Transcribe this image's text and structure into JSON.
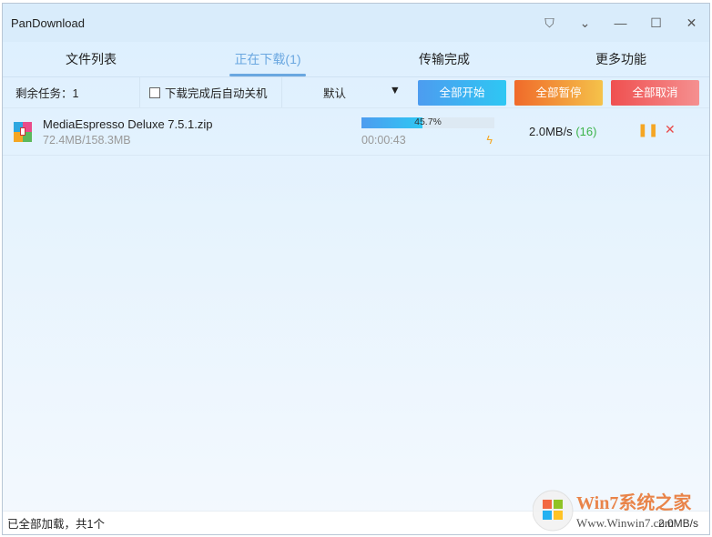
{
  "app": {
    "title": "PanDownload"
  },
  "tabs": [
    {
      "label": "文件列表"
    },
    {
      "label": "正在下载(1)"
    },
    {
      "label": "传输完成"
    },
    {
      "label": "更多功能"
    }
  ],
  "toolbar": {
    "remaining": "剩余任务：1",
    "shutdown_label": "下载完成后自动关机",
    "sort_value": "默认",
    "start_all": "全部开始",
    "pause_all": "全部暂停",
    "cancel_all": "全部取消"
  },
  "downloads": [
    {
      "name": "MediaEspresso Deluxe 7.5.1.zip",
      "size": "72.4MB/158.3MB",
      "progress_pct": 45.7,
      "progress_label": "45.7%",
      "time": "00:00:43",
      "speed": "2.0MB/s",
      "connections": "(16)"
    }
  ],
  "status": {
    "text": "已全部加载，共1个",
    "speed": "2.0MB/s"
  },
  "watermark": {
    "brand": "Win7系统之家",
    "url": "Www.Winwin7.com"
  }
}
